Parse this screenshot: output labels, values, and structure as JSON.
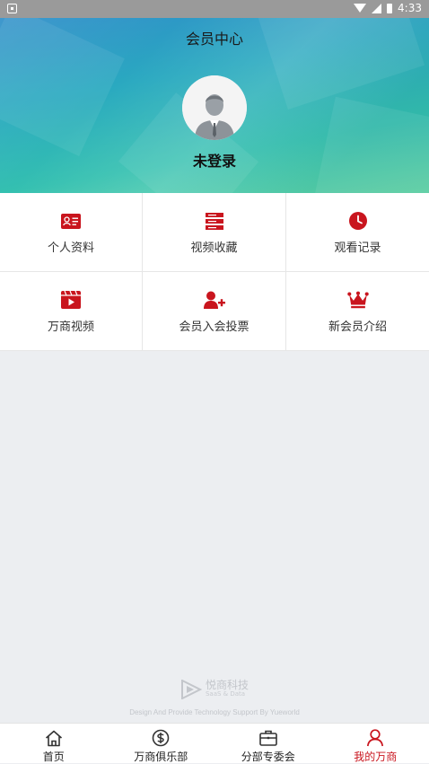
{
  "status_bar": {
    "time": "4:33"
  },
  "header": {
    "title": "会员中心",
    "login_text": "未登录"
  },
  "menu": {
    "items": [
      {
        "label": "个人资料",
        "icon": "id-card-icon"
      },
      {
        "label": "视频收藏",
        "icon": "list-icon"
      },
      {
        "label": "观看记录",
        "icon": "clock-icon"
      },
      {
        "label": "万商视频",
        "icon": "video-icon"
      },
      {
        "label": "会员入会投票",
        "icon": "user-add-icon"
      },
      {
        "label": "新会员介绍",
        "icon": "crown-icon"
      }
    ],
    "accent_color": "#c9151e"
  },
  "watermark": {
    "brand": "悦商科技",
    "sub": "SaaS & Data",
    "credit": "Design And Provide Technology Support By Yueworld"
  },
  "tabbar": {
    "tabs": [
      {
        "label": "首页",
        "icon": "home-icon",
        "active": false
      },
      {
        "label": "万商俱乐部",
        "icon": "dollar-circle-icon",
        "active": false
      },
      {
        "label": "分部专委会",
        "icon": "briefcase-icon",
        "active": false
      },
      {
        "label": "我的万商",
        "icon": "user-icon",
        "active": true
      }
    ]
  }
}
